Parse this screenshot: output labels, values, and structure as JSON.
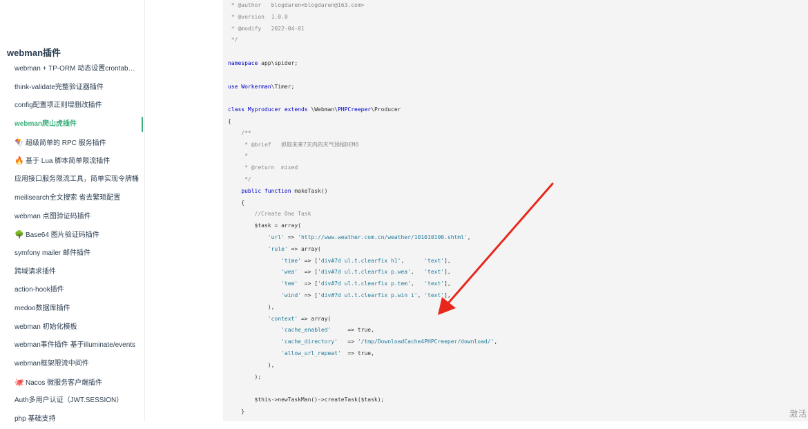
{
  "sidebar": {
    "title": "webman插件",
    "items": [
      {
        "label": "webman + TP-ORM 动态设置crontab定...",
        "emoji": ""
      },
      {
        "label": "think-validate完整验证器插件",
        "emoji": ""
      },
      {
        "label": "config配置项正则增删改插件",
        "emoji": ""
      },
      {
        "label": "webman爬山虎插件",
        "emoji": "",
        "active": true
      },
      {
        "label": "超级简单的 RPC 服务插件",
        "emoji": "🪁"
      },
      {
        "label": "基于 Lua 脚本简单限流插件",
        "emoji": "🔥"
      },
      {
        "label": "应用接口服务限流工具，简单实现令牌桶",
        "emoji": ""
      },
      {
        "label": "meilisearch全文搜索 省去繁琐配置",
        "emoji": ""
      },
      {
        "label": "webman 点图验证码插件",
        "emoji": ""
      },
      {
        "label": "Base64 图片验证码插件",
        "emoji": "🌳"
      },
      {
        "label": "symfony mailer 邮件插件",
        "emoji": ""
      },
      {
        "label": "跨域请求插件",
        "emoji": ""
      },
      {
        "label": "action-hook插件",
        "emoji": ""
      },
      {
        "label": "medoo数据库插件",
        "emoji": ""
      },
      {
        "label": "webman 初始化模板",
        "emoji": ""
      },
      {
        "label": "webman事件插件 基于illuminate/events",
        "emoji": ""
      },
      {
        "label": "webman框架限流中间件",
        "emoji": ""
      },
      {
        "label": "Nacos 微服务客户端插件",
        "emoji": "🐙"
      },
      {
        "label": "Auth多用户认证（JWT.SESSION）",
        "emoji": ""
      },
      {
        "label": "php 基础支持",
        "emoji": ""
      }
    ]
  },
  "code": {
    "lines": [
      [
        {
          "t": " * @author   blogdaren<blogdaren@163.com>",
          "c": "cm"
        }
      ],
      [
        {
          "t": " * @version  1.0.0",
          "c": "cm"
        }
      ],
      [
        {
          "t": " * @modify   2022-04-01",
          "c": "cm"
        }
      ],
      [
        {
          "t": " */",
          "c": "cm"
        }
      ],
      [],
      [
        {
          "t": "namespace ",
          "c": "kw"
        },
        {
          "t": "app\\spider;",
          "c": "var"
        }
      ],
      [],
      [
        {
          "t": "use ",
          "c": "kw"
        },
        {
          "t": "Workerman",
          "c": "kw"
        },
        {
          "t": "\\Timer;",
          "c": "var"
        }
      ],
      [],
      [
        {
          "t": "class ",
          "c": "kw"
        },
        {
          "t": "Myproducer ",
          "c": "kw"
        },
        {
          "t": "extends ",
          "c": "kw"
        },
        {
          "t": "\\Webman\\",
          "c": "var"
        },
        {
          "t": "PHPCreeper",
          "c": "kw"
        },
        {
          "t": "\\Producer",
          "c": "var"
        }
      ],
      [
        {
          "t": "{",
          "c": "var"
        }
      ],
      [
        {
          "t": "    /**",
          "c": "cm"
        }
      ],
      [
        {
          "t": "     * @brief   抓取未来7天内的天气预报DEMO",
          "c": "cm"
        }
      ],
      [
        {
          "t": "     *",
          "c": "cm"
        }
      ],
      [
        {
          "t": "     * @return  mixed",
          "c": "cm"
        }
      ],
      [
        {
          "t": "     */",
          "c": "cm"
        }
      ],
      [
        {
          "t": "    public function ",
          "c": "kw"
        },
        {
          "t": "makeTask()",
          "c": "var"
        }
      ],
      [
        {
          "t": "    {",
          "c": "var"
        }
      ],
      [
        {
          "t": "        //Create One Task",
          "c": "cm"
        }
      ],
      [
        {
          "t": "        $task = array(",
          "c": "var"
        }
      ],
      [
        {
          "t": "            ",
          "c": "var"
        },
        {
          "t": "'url'",
          "c": "str"
        },
        {
          "t": " => ",
          "c": "var"
        },
        {
          "t": "'http://www.weather.com.cn/weather/101010100.shtml'",
          "c": "str"
        },
        {
          "t": ",",
          "c": "var"
        }
      ],
      [
        {
          "t": "            ",
          "c": "var"
        },
        {
          "t": "'rule'",
          "c": "str"
        },
        {
          "t": " => array(",
          "c": "var"
        }
      ],
      [
        {
          "t": "                ",
          "c": "var"
        },
        {
          "t": "'time'",
          "c": "str"
        },
        {
          "t": " => [",
          "c": "var"
        },
        {
          "t": "'div#7d ul.t.clearfix h1'",
          "c": "str"
        },
        {
          "t": ",      ",
          "c": "var"
        },
        {
          "t": "'text'",
          "c": "str"
        },
        {
          "t": "],",
          "c": "var"
        }
      ],
      [
        {
          "t": "                ",
          "c": "var"
        },
        {
          "t": "'wea'",
          "c": "str"
        },
        {
          "t": "  => [",
          "c": "var"
        },
        {
          "t": "'div#7d ul.t.clearfix p.wea'",
          "c": "str"
        },
        {
          "t": ",   ",
          "c": "var"
        },
        {
          "t": "'text'",
          "c": "str"
        },
        {
          "t": "],",
          "c": "var"
        }
      ],
      [
        {
          "t": "                ",
          "c": "var"
        },
        {
          "t": "'tem'",
          "c": "str"
        },
        {
          "t": "  => [",
          "c": "var"
        },
        {
          "t": "'div#7d ul.t.clearfix p.tem'",
          "c": "str"
        },
        {
          "t": ",   ",
          "c": "var"
        },
        {
          "t": "'text'",
          "c": "str"
        },
        {
          "t": "],",
          "c": "var"
        }
      ],
      [
        {
          "t": "                ",
          "c": "var"
        },
        {
          "t": "'wind'",
          "c": "str"
        },
        {
          "t": " => [",
          "c": "var"
        },
        {
          "t": "'div#7d ul.t.clearfix p.win i'",
          "c": "str"
        },
        {
          "t": ", ",
          "c": "var"
        },
        {
          "t": "'text'",
          "c": "str"
        },
        {
          "t": "],",
          "c": "var"
        }
      ],
      [
        {
          "t": "            ),",
          "c": "var"
        }
      ],
      [
        {
          "t": "            ",
          "c": "var"
        },
        {
          "t": "'context'",
          "c": "str"
        },
        {
          "t": " => array(",
          "c": "var"
        }
      ],
      [
        {
          "t": "                ",
          "c": "var"
        },
        {
          "t": "'cache_enabled'",
          "c": "str"
        },
        {
          "t": "     => true,",
          "c": "var"
        }
      ],
      [
        {
          "t": "                ",
          "c": "var"
        },
        {
          "t": "'cache_directory'",
          "c": "str"
        },
        {
          "t": "   => ",
          "c": "var"
        },
        {
          "t": "'/tmp/DownloadCache4PHPCreeper/download/'",
          "c": "str"
        },
        {
          "t": ",",
          "c": "var"
        }
      ],
      [
        {
          "t": "                ",
          "c": "var"
        },
        {
          "t": "'allow_url_repeat'",
          "c": "str"
        },
        {
          "t": "  => true,",
          "c": "var"
        }
      ],
      [
        {
          "t": "            ),",
          "c": "var"
        }
      ],
      [
        {
          "t": "        );",
          "c": "var"
        }
      ],
      [],
      [
        {
          "t": "        $this->newTaskMan()->createTask($task);",
          "c": "var"
        }
      ],
      [
        {
          "t": "    }",
          "c": "var"
        }
      ]
    ]
  },
  "annotation": {
    "icon": "red-arrow-icon",
    "color": "#e8261c"
  },
  "watermark": "激活"
}
